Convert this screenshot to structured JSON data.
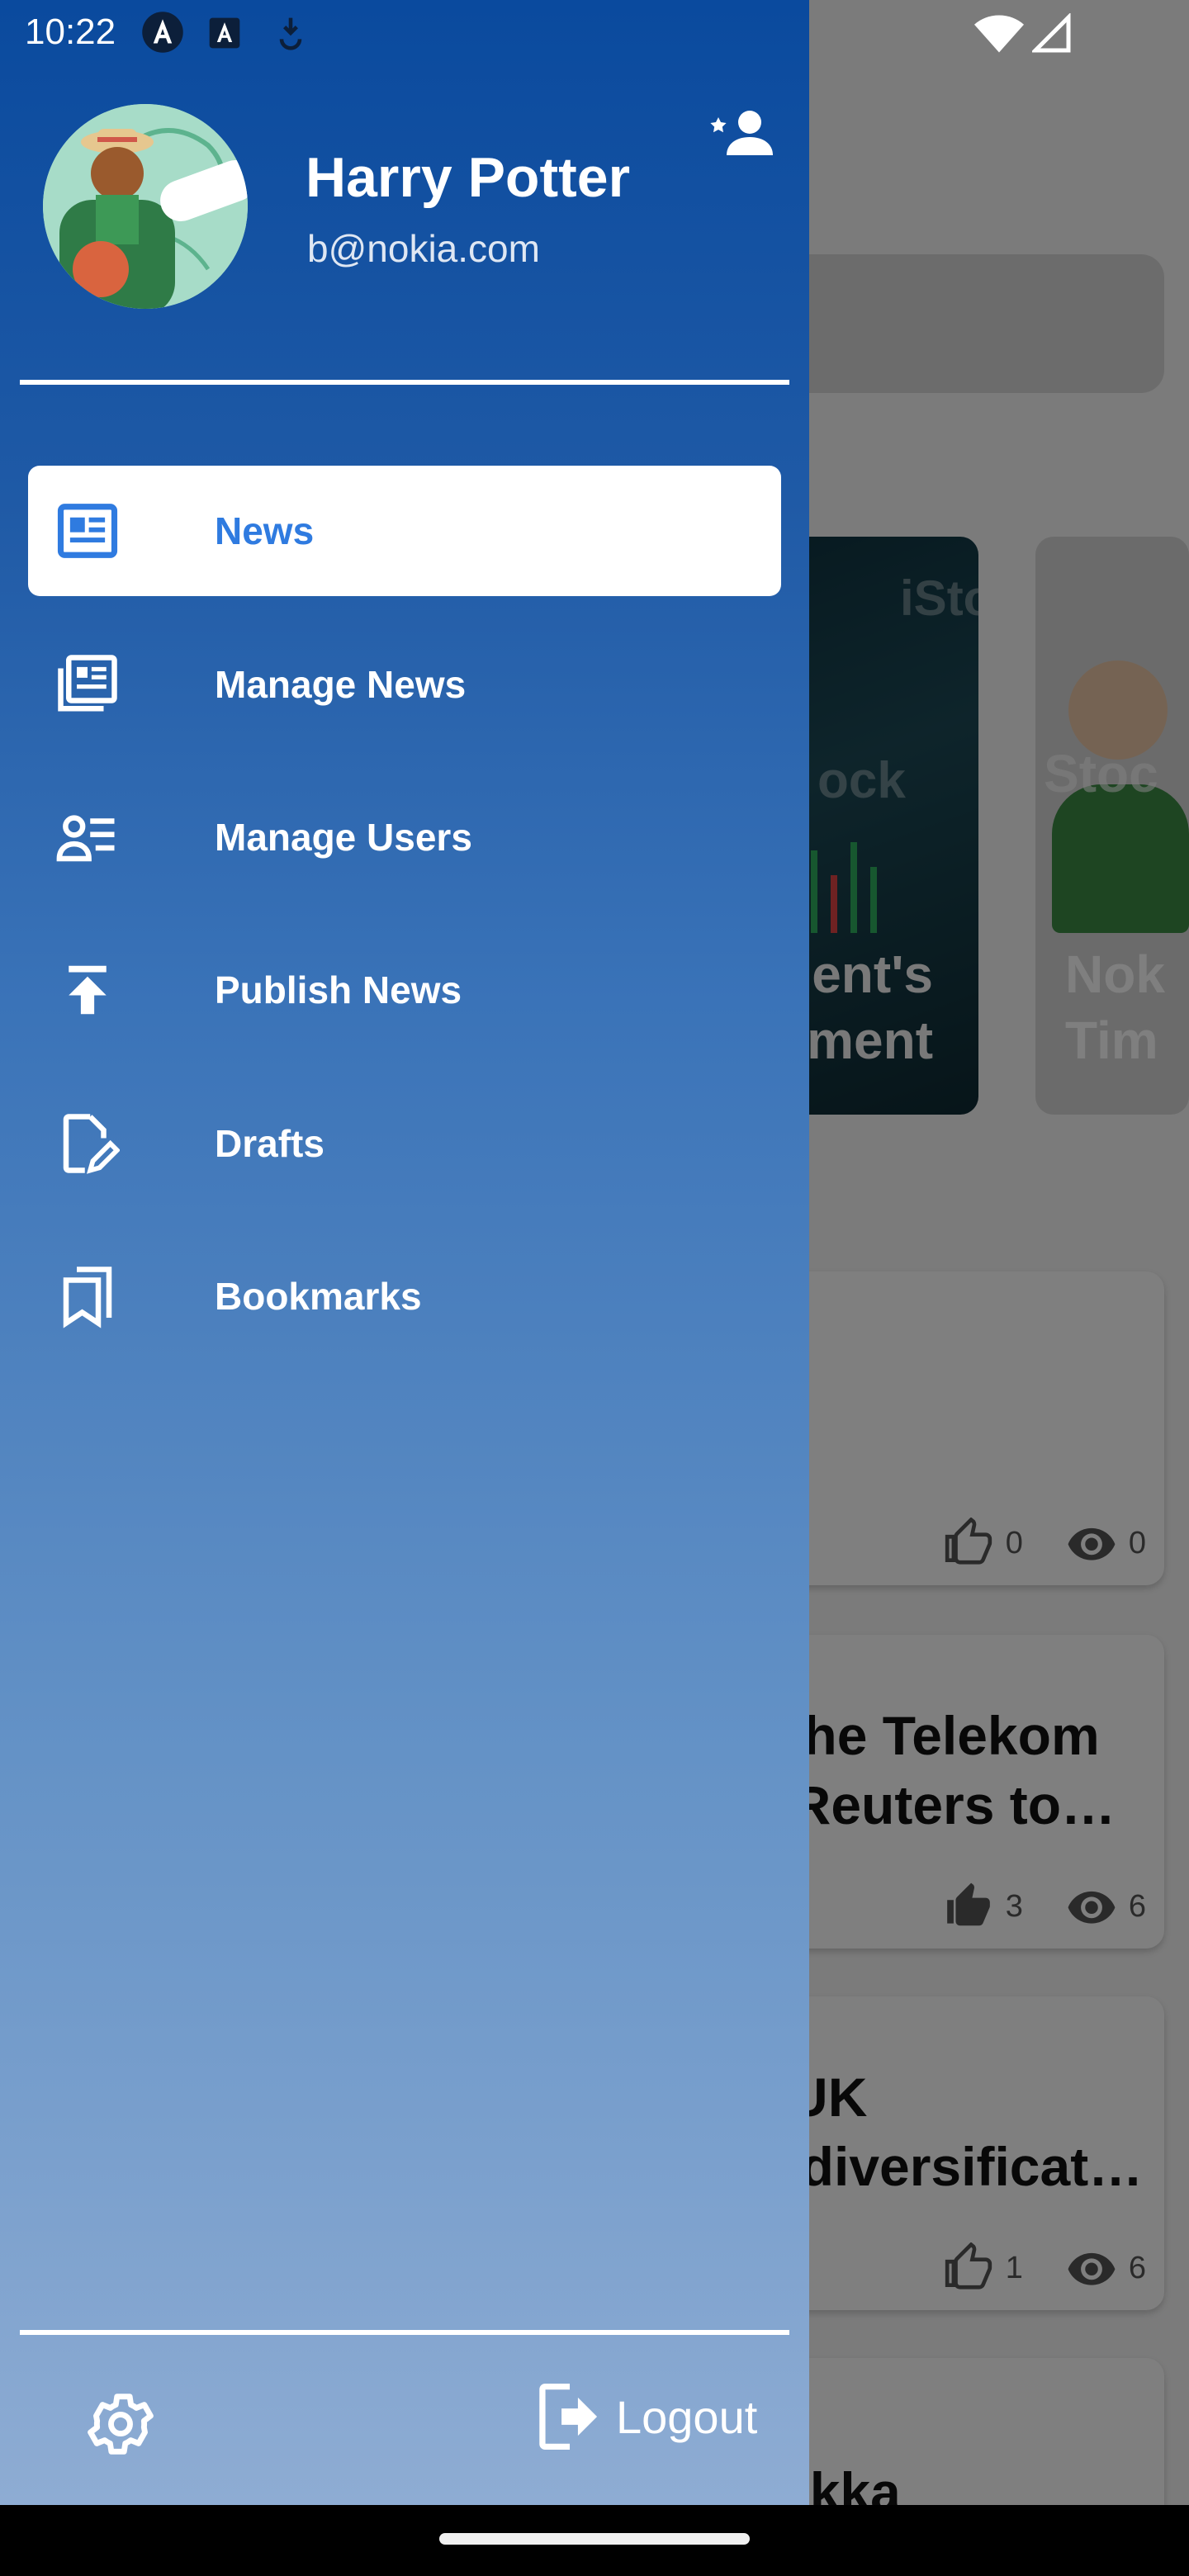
{
  "status_bar": {
    "time": "10:22",
    "icons": [
      "android-a-icon",
      "app-a-icon",
      "download-icon",
      "wifi-icon",
      "signal-icon"
    ]
  },
  "drawer": {
    "user": {
      "name": "Harry Potter",
      "email": "b@nokia.com"
    },
    "menu": [
      {
        "label": "News",
        "icon": "newspaper-icon",
        "active": true
      },
      {
        "label": "Manage News",
        "icon": "news-stack-icon",
        "active": false
      },
      {
        "label": "Manage Users",
        "icon": "manage-users-icon",
        "active": false
      },
      {
        "label": "Publish News",
        "icon": "publish-icon",
        "active": false
      },
      {
        "label": "Drafts",
        "icon": "draft-edit-icon",
        "active": false
      },
      {
        "label": "Bookmarks",
        "icon": "bookmarks-icon",
        "active": false
      }
    ],
    "footer": {
      "logout_label": "Logout"
    },
    "colors": {
      "active_text": "#2f7be0",
      "gradient_top": "#0a4a9e",
      "gradient_bottom": "#8eacd3"
    }
  },
  "background": {
    "featured": [
      {
        "title_fragment": "ent's\nment\u0013"
      },
      {
        "title_fragment": "Nok\nTim"
      }
    ],
    "news": [
      {
        "title": "",
        "likes": "0",
        "views": "0"
      },
      {
        "title": "sche Telekom\nn Reuters to…",
        "likes": "3",
        "views": "6"
      },
      {
        "title": "s UK\nG diversificat…",
        "likes": "1",
        "views": "6"
      },
      {
        "title": "Pekka"
      }
    ]
  }
}
